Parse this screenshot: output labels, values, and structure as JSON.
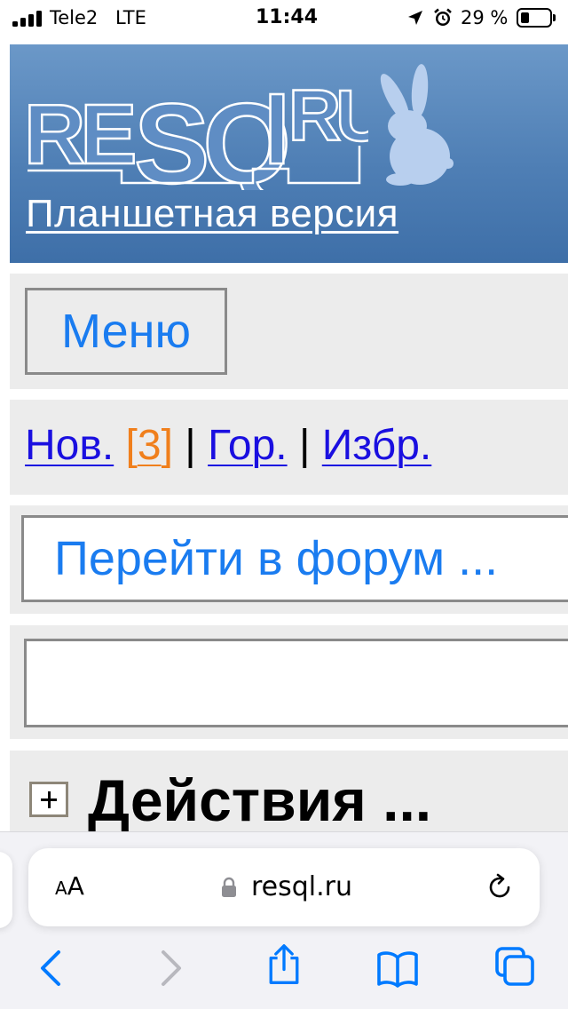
{
  "status_bar": {
    "carrier": "Tele2",
    "network": "LTE",
    "time": "11:44",
    "battery_percent": "29 %",
    "icons": [
      "signal-bars-icon",
      "location-arrow-icon",
      "alarm-clock-icon",
      "battery-icon"
    ]
  },
  "header": {
    "logo_text": "RESQL.RU",
    "tablet_link": "Планшетная версия"
  },
  "menu": {
    "button_label": "Меню"
  },
  "links": {
    "new_label": "Нов.",
    "new_bracket_open": "[",
    "new_count": "3",
    "new_bracket_close": "]",
    "separator": "|",
    "hot_label": "Гор.",
    "favorites_label": "Избр."
  },
  "forum_select": {
    "selected": "Перейти в форум ..."
  },
  "search": {
    "value": "",
    "placeholder": ""
  },
  "actions": {
    "title": "Действия ...",
    "expand_icon": "plus-box-icon"
  },
  "browser": {
    "text_size_small": "A",
    "text_size_big": "A",
    "url": "resql.ru",
    "icons": [
      "lock-icon",
      "reload-icon",
      "back-icon",
      "forward-icon",
      "share-icon",
      "bookmarks-icon",
      "tabs-icon"
    ],
    "colors": {
      "accent": "#007aff",
      "disabled": "#b8b8be"
    }
  },
  "colors": {
    "header_blue": "#4f7fb5",
    "link_blue": "#1a0fe0",
    "button_blue": "#1a7cf0",
    "counter_orange": "#f07f1c",
    "block_gray": "#ececec"
  }
}
